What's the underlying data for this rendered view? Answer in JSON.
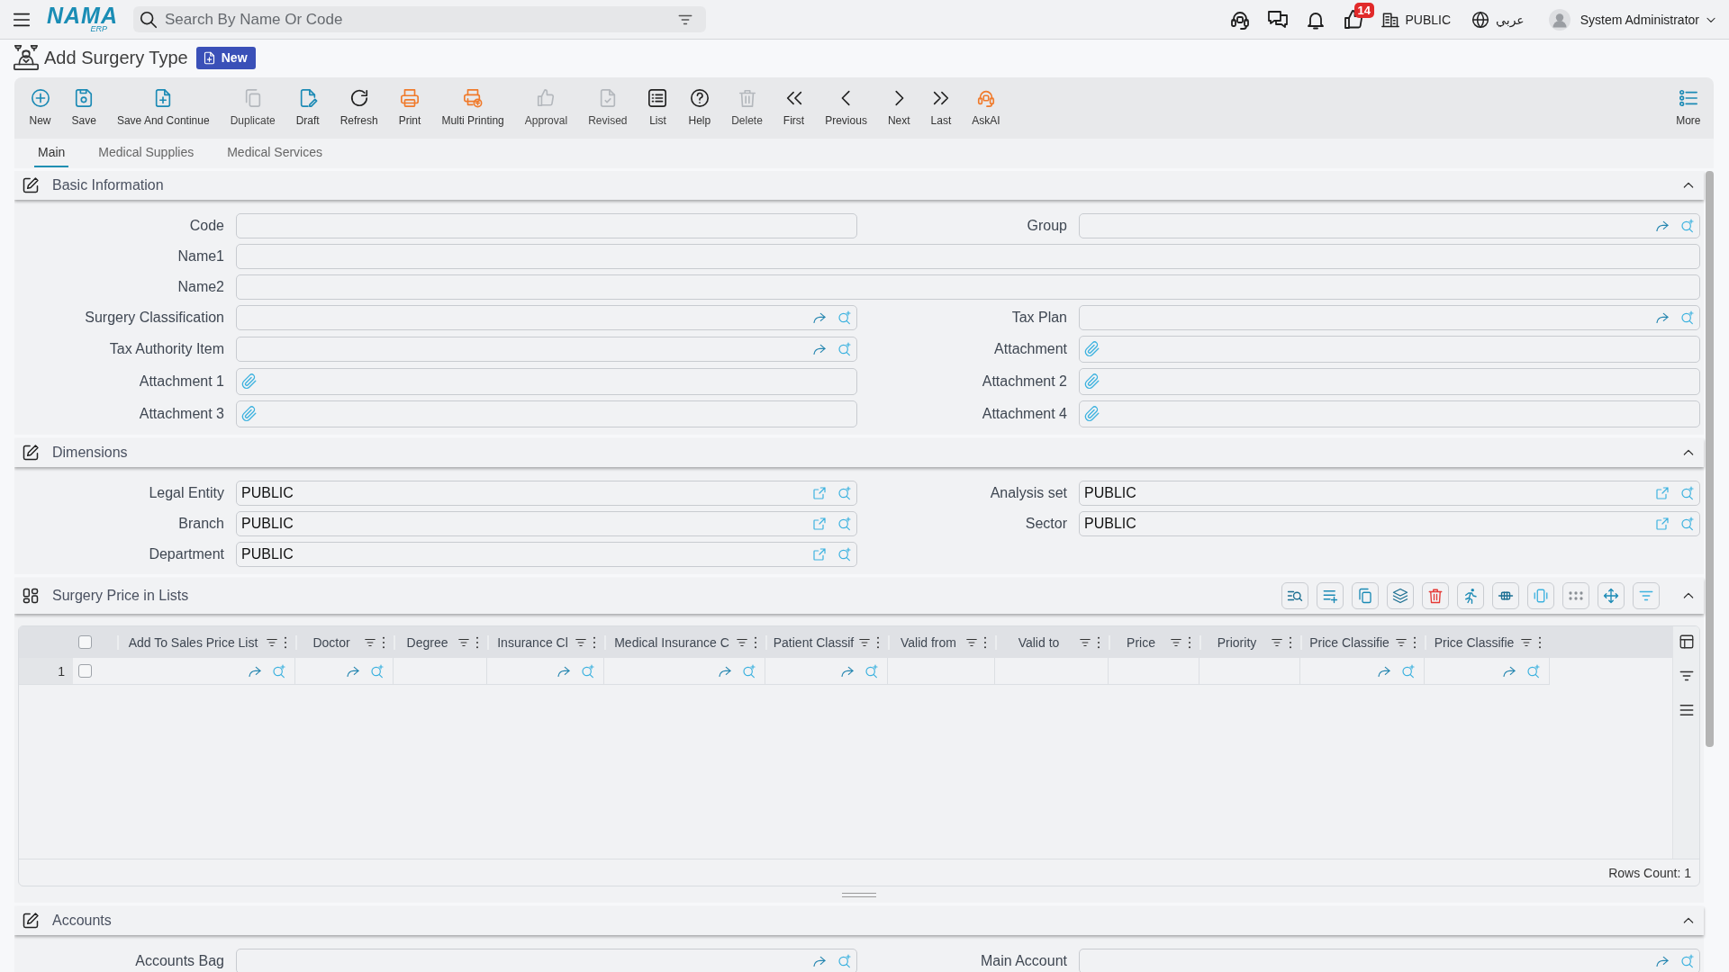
{
  "header": {
    "logo": {
      "name": "NAMA",
      "sub": "ERP"
    },
    "search": {
      "placeholder": "Search By Name Or Code"
    },
    "notifications": {
      "count": "14"
    },
    "company": "PUBLIC",
    "language": "عربي",
    "user": "System Administrator"
  },
  "page": {
    "title": "Add Surgery Type",
    "status": "New"
  },
  "toolbar": {
    "buttons": [
      {
        "label": "New",
        "disabled": false
      },
      {
        "label": "Save",
        "disabled": false
      },
      {
        "label": "Save And Continue",
        "disabled": false
      },
      {
        "label": "Duplicate",
        "disabled": true
      },
      {
        "label": "Draft",
        "disabled": false
      },
      {
        "label": "Refresh",
        "disabled": false
      },
      {
        "label": "Print",
        "disabled": false
      },
      {
        "label": "Multi Printing",
        "disabled": false
      },
      {
        "label": "Approval",
        "disabled": true
      },
      {
        "label": "Revised",
        "disabled": true
      },
      {
        "label": "List",
        "disabled": false
      },
      {
        "label": "Help",
        "disabled": false
      },
      {
        "label": "Delete",
        "disabled": true
      },
      {
        "label": "First",
        "disabled": false
      },
      {
        "label": "Previous",
        "disabled": false
      },
      {
        "label": "Next",
        "disabled": false
      },
      {
        "label": "Last",
        "disabled": false
      },
      {
        "label": "AskAI",
        "disabled": false
      }
    ],
    "more": "More"
  },
  "tabs": [
    {
      "label": "Main",
      "selected": true
    },
    {
      "label": "Medical Supplies",
      "selected": false
    },
    {
      "label": "Medical Services",
      "selected": false
    }
  ],
  "sections": [
    {
      "kind": "form",
      "title": "Basic Information",
      "expanded": true,
      "fields": [
        {
          "label": "Code",
          "kind": "text",
          "wide": false
        },
        {
          "label": "Group",
          "kind": "lookup",
          "wide": false
        },
        {
          "label": "Name1",
          "kind": "text",
          "wide": true
        },
        {
          "label": "Name2",
          "kind": "text",
          "wide": true
        },
        {
          "label": "Surgery Classification",
          "kind": "lookup",
          "wide": false
        },
        {
          "label": "Tax Plan",
          "kind": "lookup",
          "wide": false
        },
        {
          "label": "Tax Authority Item",
          "kind": "lookup",
          "wide": false
        },
        {
          "label": "Attachment",
          "kind": "attachment",
          "wide": false
        },
        {
          "label": "Attachment 1",
          "kind": "attachment",
          "wide": false
        },
        {
          "label": "Attachment 2",
          "kind": "attachment",
          "wide": false
        },
        {
          "label": "Attachment 3",
          "kind": "attachment",
          "wide": false
        },
        {
          "label": "Attachment 4",
          "kind": "attachment",
          "wide": false
        }
      ]
    },
    {
      "kind": "form",
      "title": "Dimensions",
      "expanded": true,
      "fields": [
        {
          "label": "Legal Entity",
          "kind": "dimension",
          "wide": false,
          "value": "PUBLIC"
        },
        {
          "label": "Analysis set",
          "kind": "dimension",
          "wide": false,
          "value": "PUBLIC"
        },
        {
          "label": "Branch",
          "kind": "dimension",
          "wide": false,
          "value": "PUBLIC"
        },
        {
          "label": "Sector",
          "kind": "dimension",
          "wide": false,
          "value": "PUBLIC"
        },
        {
          "label": "Department",
          "kind": "dimension",
          "wide": false,
          "value": "PUBLIC"
        }
      ]
    },
    {
      "kind": "grid",
      "title": "Surgery Price in Lists",
      "expanded": true,
      "all_selected": false,
      "columns": [
        {
          "label": "Add To Sales Price List",
          "kind": "lookup"
        },
        {
          "label": "Doctor",
          "kind": "lookup"
        },
        {
          "label": "Degree",
          "kind": "text"
        },
        {
          "label": "Insurance Cl",
          "kind": "lookup"
        },
        {
          "label": "Medical Insurance C",
          "kind": "lookup"
        },
        {
          "label": "Patient Classif",
          "kind": "lookup"
        },
        {
          "label": "Valid from",
          "kind": "text"
        },
        {
          "label": "Valid to",
          "kind": "text"
        },
        {
          "label": "Price",
          "kind": "text"
        },
        {
          "label": "Priority",
          "kind": "text"
        },
        {
          "label": "Price Classifie",
          "kind": "lookup"
        },
        {
          "label": "Price Classifie",
          "kind": "lookup"
        }
      ],
      "rows": [
        {
          "number": "1",
          "selected": false
        }
      ],
      "rows_count": "Rows Count: 1"
    },
    {
      "kind": "form",
      "title": "Accounts",
      "expanded": true,
      "fields": [
        {
          "label": "Accounts Bag",
          "kind": "lookup",
          "wide": false
        },
        {
          "label": "Main Account",
          "kind": "lookup",
          "wide": false
        }
      ]
    }
  ]
}
